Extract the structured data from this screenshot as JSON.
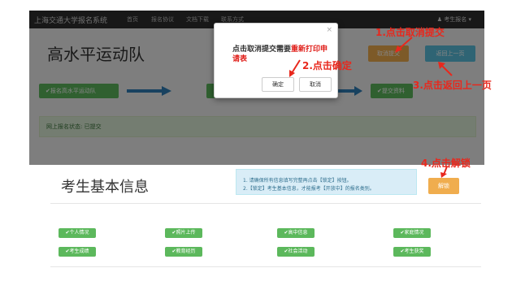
{
  "navbar": {
    "brand": "上海交通大学报名系统",
    "items": [
      "首页",
      "报名协议",
      "文档下载",
      "联系方式"
    ],
    "user": "考生报名"
  },
  "page": {
    "title": "高水平运动队",
    "cancel_button": "取消提交",
    "back_button": "返回上一页",
    "steps": [
      "报名高水平运动队",
      "提交资料"
    ],
    "status": "网上报名状态: 已提交"
  },
  "modal": {
    "close": "×",
    "message_prefix": "点击取消提交需要",
    "message_highlight": "重新打印申请表",
    "ok_label": "确定",
    "cancel_label": "取消"
  },
  "annotations": {
    "a1": "1.点击取消提交",
    "a2": "2.点击确定",
    "a3": "3.点击返回上一页",
    "a4": "4.点击解锁"
  },
  "section": {
    "title": "考生基本信息",
    "info_line1": "1. 请确保所有信息填写完整再点击【锁定】按钮。",
    "info_line2": "2.【锁定】考生基本信息，才能报考【开放中】的报名类别。",
    "unlock_label": "解锁"
  },
  "tags": [
    "个人情况",
    "照片上传",
    "高中信息",
    "家庭情况",
    "考生成绩",
    "教育经历",
    "社会活动",
    "考生获奖"
  ],
  "colors": {
    "annotation_red": "#e8281d",
    "success_green": "#5cb85c",
    "warning_orange": "#f0ad4e",
    "info_blue": "#5bc0de"
  },
  "icons": [
    "check-icon",
    "arrow-right-icon",
    "caret-down-icon",
    "close-icon"
  ]
}
